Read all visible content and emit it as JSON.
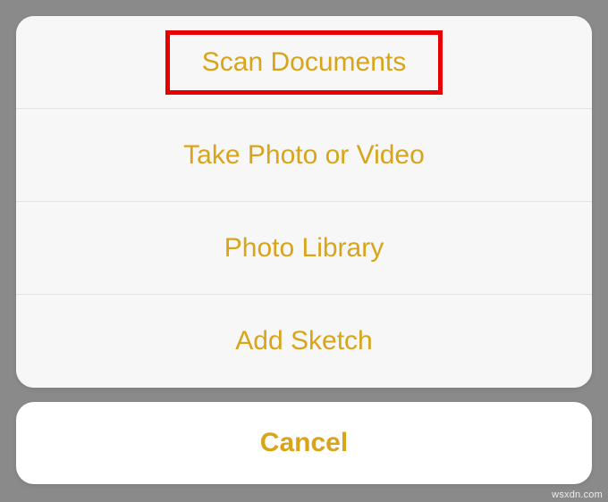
{
  "actionSheet": {
    "options": [
      {
        "label": "Scan Documents",
        "highlighted": true
      },
      {
        "label": "Take Photo or Video",
        "highlighted": false
      },
      {
        "label": "Photo Library",
        "highlighted": false
      },
      {
        "label": "Add Sketch",
        "highlighted": false
      }
    ],
    "cancel_label": "Cancel"
  },
  "watermark": "wsxdn.com",
  "colors": {
    "accent": "#d8a419",
    "highlight_border": "#e80000",
    "background": "#8a8a8a"
  }
}
